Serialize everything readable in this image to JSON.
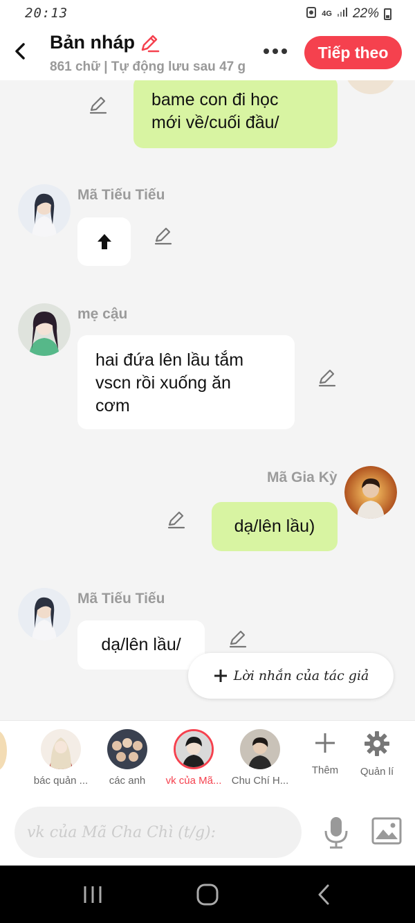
{
  "status": {
    "time": "20:13",
    "network": "4G",
    "battery": "22%"
  },
  "header": {
    "title": "Bản nháp",
    "subtitle": "861 chữ | Tự động lưu sau 47 g",
    "next_label": "Tiếp theo"
  },
  "messages": [
    {
      "side": "right",
      "sender": "",
      "text_lines": [
        "bame con đi học",
        "mới về/cuối đầu/"
      ]
    },
    {
      "side": "left",
      "sender": "Mã Tiếu Tiếu",
      "text": "⬆"
    },
    {
      "side": "left",
      "sender": "mẹ cậu",
      "text_lines": [
        "hai đứa lên lầu tắm",
        "vscn rồi xuống ăn",
        "cơm"
      ]
    },
    {
      "side": "right",
      "sender": "Mã Gia Kỳ",
      "text": "dạ/lên lầu)"
    },
    {
      "side": "left",
      "sender": "Mã Tiếu Tiếu",
      "text": "dạ/lên lầu/"
    }
  ],
  "note_button": {
    "label": "Lời nhắn của tác giả"
  },
  "characters": [
    {
      "label": "bác quản ...",
      "active": false
    },
    {
      "label": "các anh",
      "active": false
    },
    {
      "label": "vk của Mã...",
      "active": true
    },
    {
      "label": "Chu Chí H...",
      "active": false
    }
  ],
  "tools": {
    "add_label": "Thêm",
    "manage_label": "Quản lí"
  },
  "input": {
    "placeholder": "vk của Mã Cha Chì (t/g):"
  },
  "colors": {
    "accent": "#f5414e",
    "bubble_green": "#d8f4a2",
    "bubble_white": "#ffffff",
    "background": "#f4f4f4"
  }
}
